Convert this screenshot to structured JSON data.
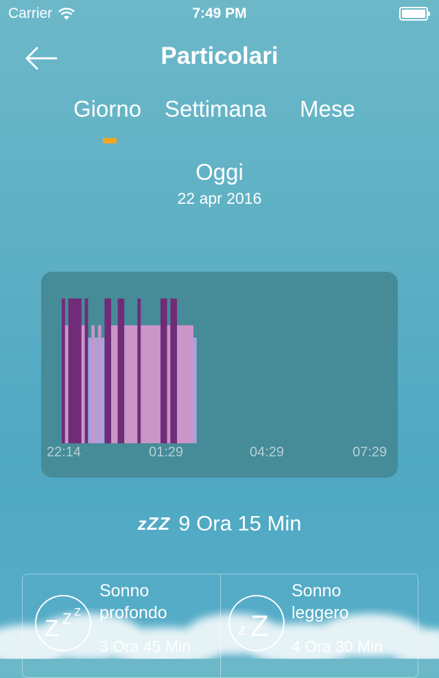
{
  "status": {
    "carrier": "Carrier",
    "time": "7:49 PM"
  },
  "header": {
    "title": "Particolari"
  },
  "tabs": [
    {
      "label": "Giorno",
      "selected": true
    },
    {
      "label": "Settimana",
      "selected": false
    },
    {
      "label": "Mese",
      "selected": false
    }
  ],
  "date": {
    "title": "Oggi",
    "subtitle": "22 apr 2016"
  },
  "chart_data": {
    "type": "bar",
    "title": "",
    "x_start": "22:14",
    "x_end": "07:29",
    "x_tick_labels": [
      "22:14",
      "01:29",
      "04:29",
      "07:29"
    ],
    "stages": [
      "deep",
      "light",
      "rem"
    ],
    "colors": {
      "deep": "#722b78",
      "light": "#c996c7",
      "rem": "#9fa6e0"
    },
    "segments": [
      {
        "start": "22:14",
        "end": "22:20",
        "stage": "deep"
      },
      {
        "start": "22:20",
        "end": "22:26",
        "stage": "light"
      },
      {
        "start": "22:26",
        "end": "22:50",
        "stage": "deep"
      },
      {
        "start": "22:50",
        "end": "22:56",
        "stage": "light"
      },
      {
        "start": "22:56",
        "end": "23:02",
        "stage": "deep"
      },
      {
        "start": "23:02",
        "end": "23:08",
        "stage": "rem"
      },
      {
        "start": "23:08",
        "end": "23:14",
        "stage": "light"
      },
      {
        "start": "23:14",
        "end": "23:20",
        "stage": "rem"
      },
      {
        "start": "23:20",
        "end": "23:26",
        "stage": "light"
      },
      {
        "start": "23:26",
        "end": "23:32",
        "stage": "rem"
      },
      {
        "start": "23:32",
        "end": "23:44",
        "stage": "deep"
      },
      {
        "start": "23:44",
        "end": "23:56",
        "stage": "light"
      },
      {
        "start": "23:56",
        "end": "00:08",
        "stage": "deep"
      },
      {
        "start": "00:08",
        "end": "00:32",
        "stage": "light"
      },
      {
        "start": "00:32",
        "end": "00:38",
        "stage": "deep"
      },
      {
        "start": "00:38",
        "end": "01:14",
        "stage": "light"
      },
      {
        "start": "01:14",
        "end": "01:26",
        "stage": "deep"
      },
      {
        "start": "01:26",
        "end": "01:32",
        "stage": "light"
      },
      {
        "start": "01:32",
        "end": "01:44",
        "stage": "deep"
      },
      {
        "start": "01:44",
        "end": "02:14",
        "stage": "light"
      },
      {
        "start": "02:14",
        "end": "02:20",
        "stage": "rem"
      }
    ]
  },
  "summary": {
    "total": "9 Ora 15 Min"
  },
  "stats": [
    {
      "line1": "Sonno",
      "line2": "profondo",
      "value": "3 Ora 45 Min",
      "icon": "deep-sleep-zzz-icon"
    },
    {
      "line1": "Sonno",
      "line2": "leggero",
      "value": "4 Ora 30 Min",
      "icon": "light-sleep-zz-icon"
    }
  ]
}
